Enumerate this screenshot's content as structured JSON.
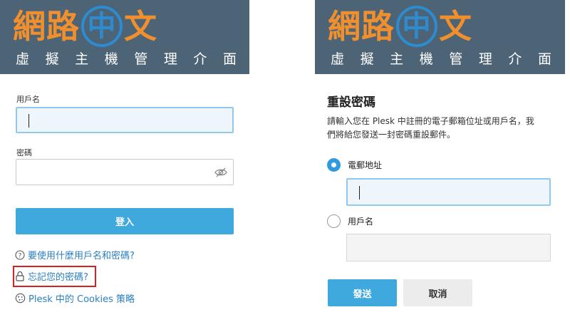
{
  "brand": {
    "logo_part1": "網路",
    "logo_circle": "中",
    "logo_part2": "文",
    "subtitle": [
      "虛",
      "擬",
      "主",
      "機",
      "管",
      "理",
      "介",
      "面"
    ],
    "header_color": "#4c6476",
    "logo_color": "#ef8f2d",
    "circle_color": "#2e8bd0"
  },
  "login": {
    "username_label": "用戶名",
    "username_value": "",
    "password_label": "密碼",
    "password_value": "",
    "login_button": "登入",
    "help_link": "要使用什麼用戶名和密碼?",
    "forgot_link": "忘記您的密碼?",
    "cookies_link": "Plesk 中的 Cookies 策略",
    "accent": "#3fa8dc",
    "link_color": "#2a7fc0",
    "highlight_color": "#d72222"
  },
  "reset": {
    "title": "重設密碼",
    "description": "請輸入您在 Plesk 中註冊的電子郵箱位址或用戶名，我們將給您發送一封密碼重設郵件。",
    "option_email": "電郵地址",
    "option_email_selected": true,
    "email_value": "",
    "option_username": "用戶名",
    "username_value": "",
    "send_button": "發送",
    "cancel_button": "取消"
  },
  "icons": {
    "eye": "eye-slash-icon",
    "help": "question-circle-icon",
    "lock": "lock-icon",
    "cookie": "cookie-icon"
  }
}
